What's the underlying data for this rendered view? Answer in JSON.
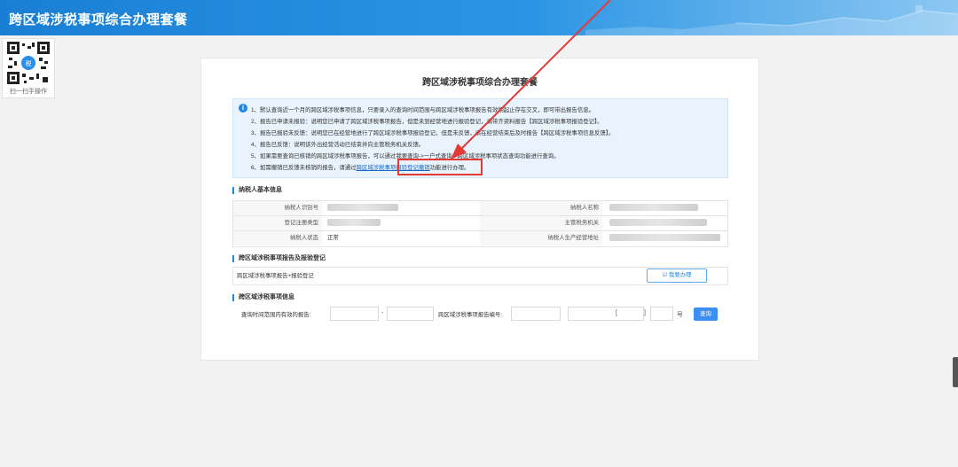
{
  "header": {
    "title": "跨区域涉税事项综合办理套餐"
  },
  "qr": {
    "caption": "扫一扫手操作"
  },
  "panel": {
    "title": "跨区域涉税事项综合办理套餐"
  },
  "notice": {
    "lines": [
      "1、默认查询近一个月的跨区域涉税事项信息，只要录入的查询时间范围与跨区域涉税事项报告有效期起止存在交叉，即可带出报告信息。",
      "2、报告已申请未报验：说明您已申请了跨区域涉税事项报告，但是未到经营地进行报验登记，请带齐资料报告【跨区域涉税事项报验登记】。",
      "3、报告已报验未反馈：说明您已在经营地进行了跨区域涉税事项报验登记，但是未反馈，请在经营结束后及时报告【跨区域涉税事项信息反馈】。",
      "4、报告已反馈：说明该外出经营活动已结束并向主管税务机关反馈。",
      "5、如果需要查询已核销的跨区域涉税事项报告，可以通过我要查询->一户式查询->跨区域涉税事项状态查询功能进行查询。"
    ],
    "line6_prefix": "6、如需撤销已反馈未核销的报告，请通过",
    "line6_link": "跨区域涉税事项报验登记撤销",
    "line6_suffix": "功能进行办理。"
  },
  "basic_info": {
    "section_title": "纳税人基本信息",
    "taxpayer_id_label": "纳税人识别号",
    "taxpayer_name_label": "纳税人名称",
    "reg_type_label": "登记注册类型",
    "tax_authority_label": "主管税务机关",
    "status_label": "纳税人状态",
    "status_value": "正常",
    "address_label": "纳税人生产经营地址"
  },
  "report": {
    "section_title": "跨区域涉税事项报告及报验登记",
    "row_text": "跨区域涉税事项报告+报验登记",
    "action_label": "☑ 我要办理"
  },
  "query": {
    "section_title": "跨区域涉税事项信息",
    "range_label": "查询时间范围内有效的报告:",
    "range_sep": "-",
    "report_no_label": "跨区域涉税事项报告编号:",
    "bracket_open": "[",
    "bracket_close": "]",
    "hao": "号",
    "search_label": "查询"
  },
  "colors": {
    "accent": "#1e88e5",
    "highlight": "#e53935",
    "header": "#1a7fd4"
  }
}
